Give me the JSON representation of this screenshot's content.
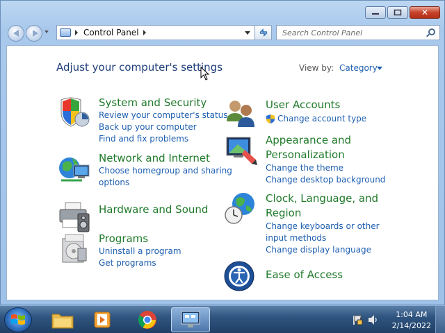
{
  "window": {
    "close_symbol": "✕",
    "minimize_symbol": "—",
    "maximize_symbol": "▢"
  },
  "address_bar": {
    "breadcrumb": "Control Panel",
    "icon": "control-panel-icon"
  },
  "search": {
    "placeholder": "Search Control Panel"
  },
  "header": {
    "title": "Adjust your computer's settings",
    "view_by_label": "View by:",
    "view_by_value": "Category"
  },
  "categories": [
    {
      "title": "System and Security",
      "icon": "shield-icon",
      "links": [
        "Review your computer's status",
        "Back up your computer",
        "Find and fix problems"
      ]
    },
    {
      "title": "Network and Internet",
      "icon": "network-globe-icon",
      "links": [
        "Choose homegroup and sharing",
        "options"
      ]
    },
    {
      "title": "Hardware and Sound",
      "icon": "printer-icon",
      "links": []
    },
    {
      "title": "Programs",
      "icon": "programs-icon",
      "links": [
        "Uninstall a program",
        "Get programs"
      ]
    },
    {
      "title": "User Accounts",
      "icon": "users-icon",
      "links": [
        "Change account type"
      ]
    },
    {
      "title_line1": "Appearance and",
      "title_line2": "Personalization",
      "icon": "appearance-icon",
      "links": [
        "Change the theme",
        "Change desktop background"
      ]
    },
    {
      "title_line1": "Clock, Language, and",
      "title_line2": "Region",
      "icon": "clock-globe-icon",
      "links": [
        "Change keyboards or other",
        "input methods",
        "Change display language"
      ]
    },
    {
      "title": "Ease of Access",
      "icon": "ease-of-access-icon",
      "links": []
    }
  ],
  "taskbar": {
    "time": "1:04 AM",
    "date": "2/14/2022"
  },
  "colors": {
    "category_title": "#1f7a2a",
    "link": "#1e5fb0",
    "title": "#1e3d78"
  }
}
